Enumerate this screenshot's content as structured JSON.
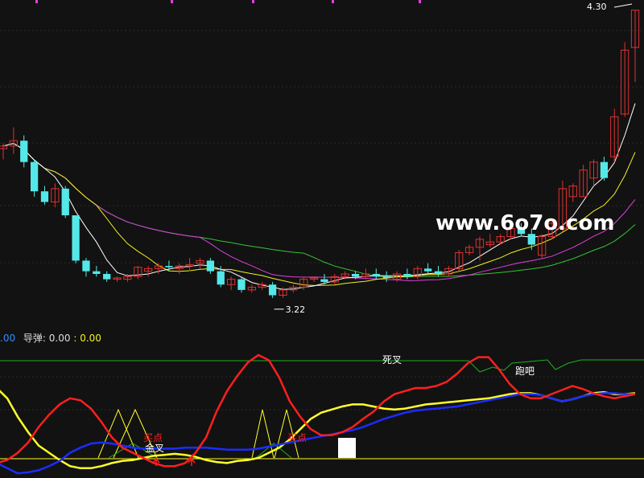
{
  "watermark": "www.6o7o.com",
  "colors": {
    "background": "#121212",
    "up_candle": "#e0312f",
    "down_candle": "#54e8e8",
    "ma_white": "#ffffff",
    "ma_yellow": "#f3f022",
    "ma_magenta": "#e040e0",
    "ma_green": "#35c535",
    "grid": "#2a2a2a",
    "ind_red": "#ff1f1f",
    "ind_yellow": "#ffff2a",
    "ind_blue": "#1c2cff",
    "ind_green_line": "#20b020"
  },
  "main_chart": {
    "high_label": "4.30",
    "low_label": "3.22"
  },
  "indicator_panel": {
    "legend": {
      "prefix": ".00",
      "name": "导弹:",
      "value1": "0.00",
      "separator": ":",
      "value2": "0.00"
    },
    "annotations": {
      "death_cross": "死叉",
      "run": "跑吧",
      "buy_point_1": "买点",
      "golden_cross": "金叉",
      "buy_point_2": "买点"
    }
  },
  "chart_data": [
    {
      "type": "candlestick",
      "title": "",
      "candles": [
        [
          3.78,
          3.8,
          3.74,
          3.79
        ],
        [
          3.79,
          3.86,
          3.76,
          3.81
        ],
        [
          3.81,
          3.83,
          3.71,
          3.73
        ],
        [
          3.73,
          3.74,
          3.6,
          3.62
        ],
        [
          3.62,
          3.64,
          3.57,
          3.58
        ],
        [
          3.58,
          3.65,
          3.56,
          3.63
        ],
        [
          3.63,
          3.64,
          3.52,
          3.53
        ],
        [
          3.53,
          3.53,
          3.35,
          3.36
        ],
        [
          3.36,
          3.37,
          3.3,
          3.32
        ],
        [
          3.32,
          3.34,
          3.3,
          3.31
        ],
        [
          3.31,
          3.32,
          3.28,
          3.29
        ],
        [
          3.29,
          3.3,
          3.28,
          3.295
        ],
        [
          3.29,
          3.31,
          3.28,
          3.3
        ],
        [
          3.3,
          3.34,
          3.29,
          3.335
        ],
        [
          3.32,
          3.34,
          3.3,
          3.33
        ],
        [
          3.33,
          3.35,
          3.31,
          3.34
        ],
        [
          3.34,
          3.36,
          3.32,
          3.335
        ],
        [
          3.33,
          3.35,
          3.31,
          3.34
        ],
        [
          3.34,
          3.37,
          3.32,
          3.345
        ],
        [
          3.35,
          3.37,
          3.33,
          3.36
        ],
        [
          3.36,
          3.37,
          3.31,
          3.32
        ],
        [
          3.32,
          3.34,
          3.26,
          3.27
        ],
        [
          3.27,
          3.3,
          3.25,
          3.29
        ],
        [
          3.29,
          3.3,
          3.24,
          3.25
        ],
        [
          3.25,
          3.27,
          3.24,
          3.26
        ],
        [
          3.26,
          3.28,
          3.25,
          3.27
        ],
        [
          3.27,
          3.28,
          3.22,
          3.23
        ],
        [
          3.23,
          3.26,
          3.22,
          3.25
        ],
        [
          3.25,
          3.27,
          3.24,
          3.26
        ],
        [
          3.26,
          3.3,
          3.25,
          3.29
        ],
        [
          3.29,
          3.3,
          3.28,
          3.295
        ],
        [
          3.29,
          3.31,
          3.27,
          3.28
        ],
        [
          3.28,
          3.31,
          3.27,
          3.3
        ],
        [
          3.3,
          3.32,
          3.29,
          3.31
        ],
        [
          3.31,
          3.32,
          3.29,
          3.3
        ],
        [
          3.3,
          3.33,
          3.29,
          3.31
        ],
        [
          3.31,
          3.33,
          3.29,
          3.3
        ],
        [
          3.3,
          3.32,
          3.28,
          3.295
        ],
        [
          3.29,
          3.32,
          3.28,
          3.31
        ],
        [
          3.31,
          3.33,
          3.29,
          3.3
        ],
        [
          3.3,
          3.34,
          3.29,
          3.33
        ],
        [
          3.33,
          3.35,
          3.31,
          3.32
        ],
        [
          3.32,
          3.34,
          3.3,
          3.31
        ],
        [
          3.31,
          3.34,
          3.3,
          3.33
        ],
        [
          3.33,
          3.4,
          3.32,
          3.39
        ],
        [
          3.39,
          3.42,
          3.38,
          3.41
        ],
        [
          3.41,
          3.45,
          3.36,
          3.44
        ],
        [
          3.42,
          3.46,
          3.41,
          3.43
        ],
        [
          3.43,
          3.46,
          3.42,
          3.45
        ],
        [
          3.45,
          3.49,
          3.44,
          3.48
        ],
        [
          3.48,
          3.5,
          3.45,
          3.46
        ],
        [
          3.46,
          3.48,
          3.4,
          3.42
        ],
        [
          3.38,
          3.46,
          3.37,
          3.45
        ],
        [
          3.45,
          3.51,
          3.44,
          3.5
        ],
        [
          3.48,
          3.66,
          3.47,
          3.63
        ],
        [
          3.6,
          3.65,
          3.58,
          3.64
        ],
        [
          3.6,
          3.72,
          3.6,
          3.7
        ],
        [
          3.67,
          3.74,
          3.64,
          3.73
        ],
        [
          3.73,
          3.75,
          3.66,
          3.67
        ],
        [
          3.75,
          3.93,
          3.73,
          3.9
        ],
        [
          3.91,
          4.18,
          3.9,
          4.15
        ],
        [
          4.16,
          4.3,
          4.03,
          4.3
        ]
      ],
      "high": 4.3,
      "low": 3.22,
      "ylim": [
        3.12,
        4.32
      ]
    },
    {
      "type": "line",
      "title": "",
      "series": [
        {
          "name": "",
          "values": [
            68,
            58,
            40,
            25,
            12,
            5,
            -2,
            -8,
            -10,
            -10,
            -8,
            -5,
            -3,
            -2,
            0,
            2,
            3,
            4,
            3,
            1,
            -2,
            -4,
            -5,
            -3,
            -2,
            0,
            5,
            10,
            18,
            28,
            38,
            44,
            47,
            50,
            52,
            52,
            50,
            48,
            47,
            48,
            50,
            52,
            53,
            54,
            55,
            56,
            57,
            58,
            60,
            62,
            63,
            63,
            61,
            58,
            55,
            57,
            60,
            63,
            64,
            62,
            62,
            63
          ]
        },
        {
          "name": "",
          "values": [
            -5,
            -10,
            -15,
            -14,
            -12,
            -8,
            -3,
            5,
            10,
            14,
            15,
            14,
            12,
            10,
            9,
            9,
            9,
            9,
            10,
            10,
            10,
            9,
            8,
            8,
            8,
            9,
            11,
            13,
            15,
            17,
            19,
            21,
            23,
            25,
            27,
            30,
            34,
            38,
            41,
            44,
            46,
            47,
            48,
            49,
            50,
            52,
            54,
            56,
            58,
            60,
            62,
            62,
            61,
            58,
            55,
            57,
            60,
            62,
            63,
            63,
            62,
            62
          ]
        },
        {
          "name": "",
          "values": [
            -5,
            -10,
            -15,
            -10,
            -4,
            0,
            3,
            6,
            8,
            10,
            11,
            12,
            12,
            12,
            11,
            10,
            10,
            11,
            12,
            13,
            13,
            12,
            10,
            8,
            7,
            7,
            7,
            8,
            10,
            13,
            17,
            21,
            25,
            28,
            31,
            34,
            37,
            40,
            42,
            44,
            46,
            48,
            50,
            52,
            54,
            56,
            58,
            60,
            62,
            64,
            66,
            68,
            67,
            63,
            59,
            58,
            59,
            61,
            62,
            63,
            63,
            63
          ]
        },
        {
          "name": "",
          "values": [
            -5,
            -2,
            5,
            15,
            30,
            42,
            52,
            58,
            56,
            48,
            35,
            20,
            10,
            5,
            0,
            -5,
            -8,
            -8,
            -5,
            5,
            20,
            45,
            65,
            80,
            93,
            100,
            95,
            78,
            55,
            40,
            28,
            22,
            22,
            25,
            30,
            38,
            45,
            55,
            62,
            65,
            68,
            68,
            70,
            74,
            82,
            92,
            98,
            98,
            86,
            72,
            62,
            58,
            58,
            62,
            66,
            70,
            67,
            63,
            60,
            58,
            60,
            62
          ]
        }
      ]
    }
  ]
}
